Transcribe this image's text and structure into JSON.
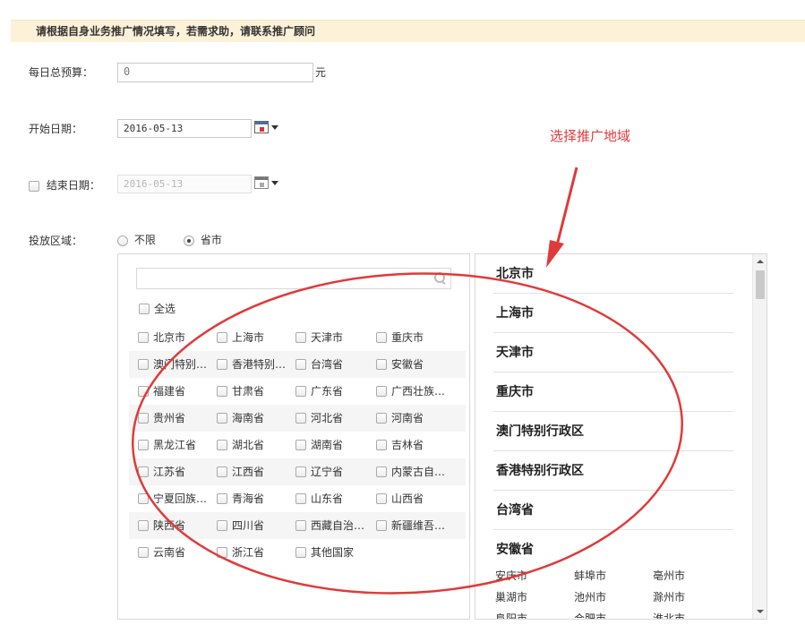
{
  "notice": "请根据自身业务推广情况填写，若需求助，请联系推广顾问",
  "budget": {
    "label": "每日总预算：",
    "value": "0",
    "unit": "元"
  },
  "start_date": {
    "label": "开始日期：",
    "value": "2016-05-13"
  },
  "end_date": {
    "label": "结束日期：",
    "value": "2016-05-13"
  },
  "region": {
    "label": "投放区域：",
    "options": [
      "不限",
      "省市"
    ],
    "selected": "省市"
  },
  "select_all": "全选",
  "province_grid": [
    [
      "北京市",
      "上海市",
      "天津市",
      "重庆市"
    ],
    [
      "澳门特别…",
      "香港特别…",
      "台湾省",
      "安徽省"
    ],
    [
      "福建省",
      "甘肃省",
      "广东省",
      "广西壮族…"
    ],
    [
      "贵州省",
      "海南省",
      "河北省",
      "河南省"
    ],
    [
      "黑龙江省",
      "湖北省",
      "湖南省",
      "吉林省"
    ],
    [
      "江苏省",
      "江西省",
      "辽宁省",
      "内蒙古自…"
    ],
    [
      "宁夏回族…",
      "青海省",
      "山东省",
      "山西省"
    ],
    [
      "陕西省",
      "四川省",
      "西藏自治…",
      "新疆维吾…"
    ],
    [
      "云南省",
      "浙江省",
      "其他国家"
    ]
  ],
  "selected_list": [
    "北京市",
    "上海市",
    "天津市",
    "重庆市",
    "澳门特别行政区",
    "香港特别行政区",
    "台湾省",
    "安徽省"
  ],
  "anhui_cities": [
    [
      "安庆市",
      "蚌埠市",
      "亳州市"
    ],
    [
      "巢湖市",
      "池州市",
      "滁州市"
    ],
    [
      "阜阳市",
      "合肥市",
      "淮北市"
    ]
  ],
  "annotation": "选择推广地域",
  "colors": {
    "annotation": "#e03a3a",
    "notice_bg": "#fdf1d8"
  }
}
